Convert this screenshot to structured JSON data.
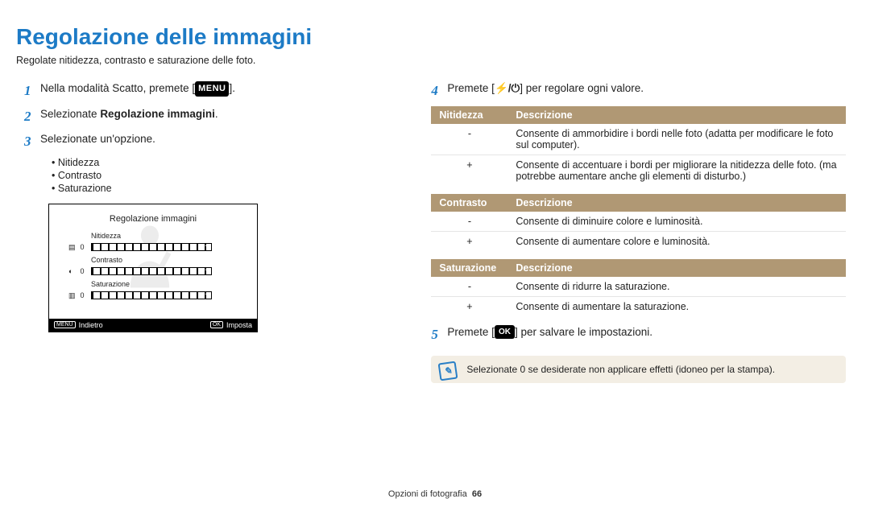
{
  "title": "Regolazione delle immagini",
  "subtitle": "Regolate nitidezza, contrasto e saturazione delle foto.",
  "steps": {
    "s1_pre": "Nella modalità Scatto, premete [",
    "s1_badge": "MENU",
    "s1_post": "].",
    "s2_pre": "Selezionate ",
    "s2_bold": "Regolazione immagini",
    "s2_post": ".",
    "s3": "Selezionate un'opzione.",
    "s4_pre": "Premete [",
    "s4_icons": "⚡/⏻",
    "s4_post": "] per regolare ogni valore.",
    "s5_pre": "Premete [",
    "s5_badge": "OK",
    "s5_post": "] per salvare le impostazioni."
  },
  "bullets": [
    "Nitidezza",
    "Contrasto",
    "Saturazione"
  ],
  "figure": {
    "title": "Regolazione immagini",
    "rows": [
      {
        "icon": "▤",
        "label": "Nitidezza",
        "value": "0"
      },
      {
        "icon": "◐",
        "label": "Contrasto",
        "value": "0"
      },
      {
        "icon": "▥",
        "label": "Saturazione",
        "value": "0"
      }
    ],
    "footer_left_badge": "MENU",
    "footer_left": "Indietro",
    "footer_right_badge": "OK",
    "footer_right": "Imposta"
  },
  "tables": [
    {
      "head1": "Nitidezza",
      "head2": "Descrizione",
      "rows": [
        {
          "sym": "-",
          "desc": "Consente di ammorbidire i bordi nelle foto (adatta per modificare le foto sul computer)."
        },
        {
          "sym": "+",
          "desc": "Consente di accentuare i bordi per migliorare la nitidezza delle foto. (ma potrebbe aumentare anche gli elementi di disturbo.)"
        }
      ]
    },
    {
      "head1": "Contrasto",
      "head2": "Descrizione",
      "rows": [
        {
          "sym": "-",
          "desc": "Consente di diminuire colore e luminosità."
        },
        {
          "sym": "+",
          "desc": "Consente di aumentare colore e luminosità."
        }
      ]
    },
    {
      "head1": "Saturazione",
      "head2": "Descrizione",
      "rows": [
        {
          "sym": "-",
          "desc": "Consente di ridurre la saturazione."
        },
        {
          "sym": "+",
          "desc": "Consente di aumentare la saturazione."
        }
      ]
    }
  ],
  "note": "Selezionate 0 se desiderate non applicare effetti (idoneo per la stampa).",
  "footer": {
    "section": "Opzioni di fotografia",
    "page": "66"
  }
}
